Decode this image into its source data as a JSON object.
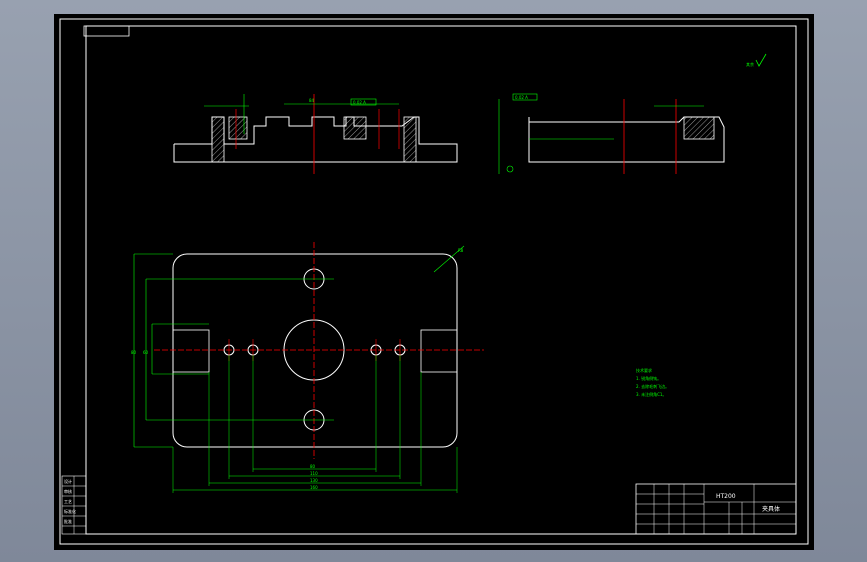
{
  "drawing": {
    "part_number_text": "HT200",
    "part_name_text": "夹具体",
    "tech_req_title": "技术要求",
    "tech_req_lines": [
      "1. 锐角倒钝。",
      "2. 去除毛刺飞边。",
      "3. 未注倒角C1。"
    ],
    "surface_mark": "其余",
    "side_left_block": [
      "设计",
      "审核",
      "工艺",
      "标准化",
      "批准"
    ],
    "dims": {
      "left_top_box": "0.02 A",
      "right_top_box": "0.02 A",
      "left_width": "84",
      "mid_width": "100",
      "plan_dims": [
        "80",
        "110",
        "130",
        "160"
      ],
      "plan_height": "80",
      "plan_height2": "60",
      "radius": "R8"
    }
  },
  "colors": {
    "background": "#000000",
    "line_white": "#ffffff",
    "line_green": "#00ff00",
    "line_red": "#ff0000"
  }
}
